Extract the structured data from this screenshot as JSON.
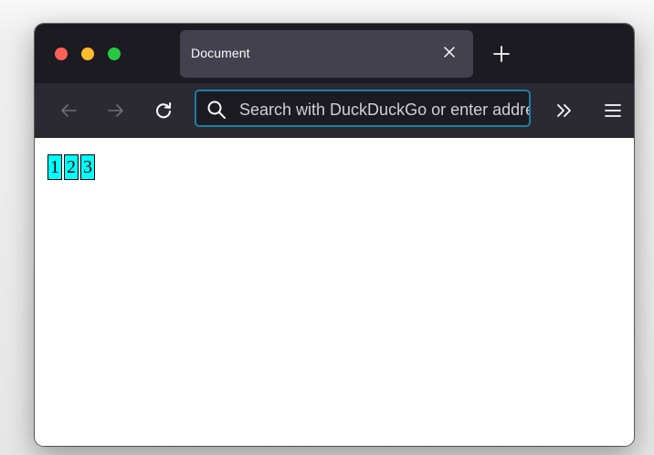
{
  "tab": {
    "title": "Document"
  },
  "toolbar": {
    "search_placeholder": "Search with DuckDuckGo or enter address"
  },
  "icons": {
    "back": "back-arrow-icon",
    "forward": "forward-arrow-icon",
    "reload": "reload-icon",
    "search": "search-icon",
    "overflow": "chevron-double-right-icon",
    "menu": "hamburger-menu-icon",
    "close_tab": "close-icon",
    "new_tab": "plus-icon"
  },
  "colors": {
    "window_controls": [
      "#fe5f57",
      "#febc2e",
      "#28c840"
    ],
    "tab_strip": "#1c1b22",
    "toolbar": "#2b2a33",
    "url_focus_ring": "#1f7ea1",
    "box_fill": "#00ffff"
  },
  "content": {
    "boxes": [
      "1",
      "2",
      "3"
    ]
  }
}
